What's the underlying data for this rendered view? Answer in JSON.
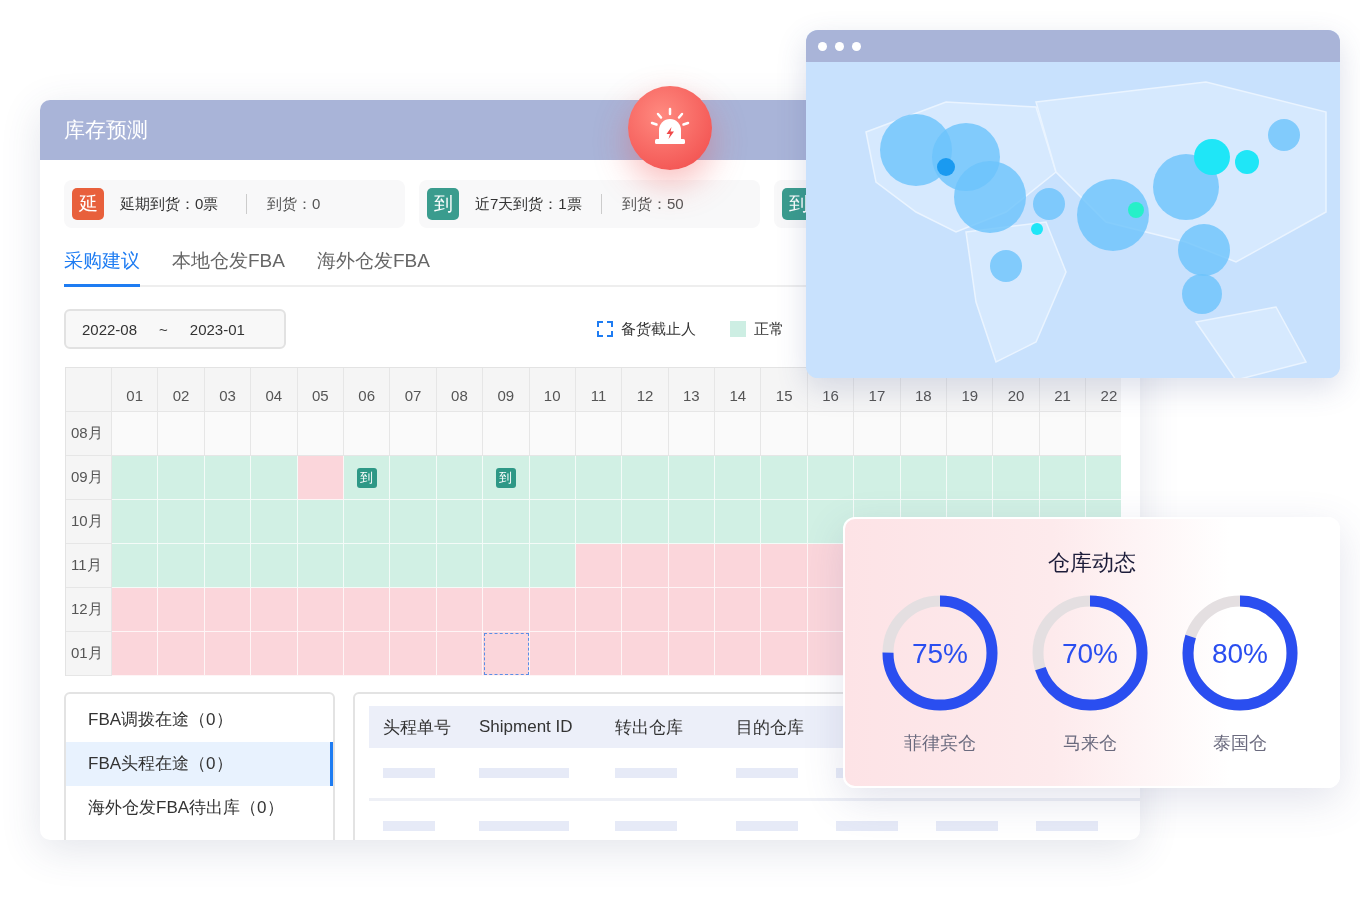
{
  "main_panel": {
    "title": "库存预测",
    "stats": [
      {
        "badge": "延",
        "color": "#e8603c",
        "label": "延期到货：0票",
        "value": "到货：0"
      },
      {
        "badge": "到",
        "color": "#3a9c8e",
        "label": "近7天到货：1票",
        "value": "到货：50"
      },
      {
        "badge": "到",
        "color": "#3a9c8e"
      }
    ],
    "tabs": [
      {
        "label": "采购建议",
        "selected": true
      },
      {
        "label": "本地仓发FBA",
        "selected": false
      },
      {
        "label": "海外仓发FBA",
        "selected": false
      }
    ],
    "date_range": {
      "start": "2022-08",
      "separator": "~",
      "end": "2023-01"
    },
    "legend": [
      {
        "kind": "deadline",
        "label": "备货截止人"
      },
      {
        "kind": "normal",
        "label": "正常"
      }
    ],
    "calendar": {
      "days": [
        "01",
        "02",
        "03",
        "04",
        "05",
        "06",
        "07",
        "08",
        "09",
        "10",
        "11",
        "12",
        "13",
        "14",
        "15",
        "16",
        "17",
        "18",
        "19",
        "20",
        "21",
        "22"
      ],
      "rows": [
        {
          "month": "08月",
          "cells": [
            {
              "kind": "empty"
            },
            {
              "kind": "empty"
            },
            {
              "kind": "empty"
            },
            {
              "kind": "empty"
            },
            {
              "kind": "empty"
            },
            {
              "kind": "empty"
            },
            {
              "kind": "empty"
            },
            {
              "kind": "empty"
            },
            {
              "kind": "empty"
            },
            {
              "kind": "empty"
            },
            {
              "kind": "empty"
            },
            {
              "kind": "empty"
            },
            {
              "kind": "empty"
            },
            {
              "kind": "empty"
            },
            {
              "kind": "empty"
            },
            {
              "kind": "empty"
            },
            {
              "kind": "empty"
            },
            {
              "kind": "empty"
            },
            {
              "kind": "empty"
            },
            {
              "kind": "empty"
            },
            {
              "kind": "empty"
            },
            {
              "kind": "empty"
            }
          ]
        },
        {
          "month": "09月",
          "cells": [
            {
              "kind": "normal"
            },
            {
              "kind": "normal"
            },
            {
              "kind": "normal"
            },
            {
              "kind": "normal"
            },
            {
              "kind": "short"
            },
            {
              "kind": "normal",
              "badge": "到"
            },
            {
              "kind": "normal"
            },
            {
              "kind": "normal"
            },
            {
              "kind": "normal",
              "badge": "到"
            },
            {
              "kind": "normal"
            },
            {
              "kind": "normal"
            },
            {
              "kind": "normal"
            },
            {
              "kind": "normal"
            },
            {
              "kind": "normal"
            },
            {
              "kind": "normal"
            },
            {
              "kind": "normal"
            },
            {
              "kind": "normal"
            },
            {
              "kind": "normal"
            },
            {
              "kind": "normal"
            },
            {
              "kind": "normal"
            },
            {
              "kind": "normal"
            },
            {
              "kind": "normal"
            }
          ]
        },
        {
          "month": "10月",
          "cells": [
            {
              "kind": "normal"
            },
            {
              "kind": "normal"
            },
            {
              "kind": "normal"
            },
            {
              "kind": "normal"
            },
            {
              "kind": "normal"
            },
            {
              "kind": "normal"
            },
            {
              "kind": "normal"
            },
            {
              "kind": "normal"
            },
            {
              "kind": "normal"
            },
            {
              "kind": "normal"
            },
            {
              "kind": "normal"
            },
            {
              "kind": "normal"
            },
            {
              "kind": "normal"
            },
            {
              "kind": "normal"
            },
            {
              "kind": "normal"
            },
            {
              "kind": "normal"
            },
            {
              "kind": "normal"
            },
            {
              "kind": "normal"
            },
            {
              "kind": "normal"
            },
            {
              "kind": "normal"
            },
            {
              "kind": "normal"
            },
            {
              "kind": "normal"
            }
          ]
        },
        {
          "month": "11月",
          "cells": [
            {
              "kind": "normal"
            },
            {
              "kind": "normal"
            },
            {
              "kind": "normal"
            },
            {
              "kind": "normal"
            },
            {
              "kind": "normal"
            },
            {
              "kind": "normal"
            },
            {
              "kind": "normal"
            },
            {
              "kind": "normal"
            },
            {
              "kind": "normal"
            },
            {
              "kind": "normal"
            },
            {
              "kind": "short"
            },
            {
              "kind": "short"
            },
            {
              "kind": "short"
            },
            {
              "kind": "short"
            },
            {
              "kind": "short"
            },
            {
              "kind": "short"
            }
          ]
        },
        {
          "month": "12月",
          "cells": [
            {
              "kind": "short"
            },
            {
              "kind": "short"
            },
            {
              "kind": "short"
            },
            {
              "kind": "short"
            },
            {
              "kind": "short"
            },
            {
              "kind": "short"
            },
            {
              "kind": "short"
            },
            {
              "kind": "short"
            },
            {
              "kind": "short"
            },
            {
              "kind": "short"
            },
            {
              "kind": "short"
            },
            {
              "kind": "short"
            },
            {
              "kind": "short"
            },
            {
              "kind": "short"
            },
            {
              "kind": "short"
            },
            {
              "kind": "short"
            }
          ]
        },
        {
          "month": "01月",
          "cells": [
            {
              "kind": "short"
            },
            {
              "kind": "short"
            },
            {
              "kind": "short"
            },
            {
              "kind": "short"
            },
            {
              "kind": "short"
            },
            {
              "kind": "short"
            },
            {
              "kind": "short"
            },
            {
              "kind": "short"
            },
            {
              "kind": "deadline"
            },
            {
              "kind": "short"
            },
            {
              "kind": "short"
            },
            {
              "kind": "short"
            },
            {
              "kind": "short"
            },
            {
              "kind": "short"
            },
            {
              "kind": "short"
            },
            {
              "kind": "short"
            }
          ]
        }
      ]
    },
    "transit_list": [
      {
        "label": "FBA调拨在途（0）",
        "selected": false
      },
      {
        "label": "FBA头程在途（0）",
        "selected": true
      },
      {
        "label": "海外仓发FBA待出库（0）",
        "selected": false
      }
    ],
    "shipment_table": {
      "columns": [
        "头程单号",
        "Shipment ID",
        "转出仓库",
        "目的仓库"
      ]
    }
  },
  "warehouse_card": {
    "title": "仓库动态",
    "gauges": [
      {
        "value": "75%",
        "level": 0.75,
        "name": "菲律宾仓"
      },
      {
        "value": "70%",
        "level": 0.7,
        "name": "马来仓"
      },
      {
        "value": "80%",
        "level": 0.8,
        "name": "泰国仓"
      }
    ]
  }
}
